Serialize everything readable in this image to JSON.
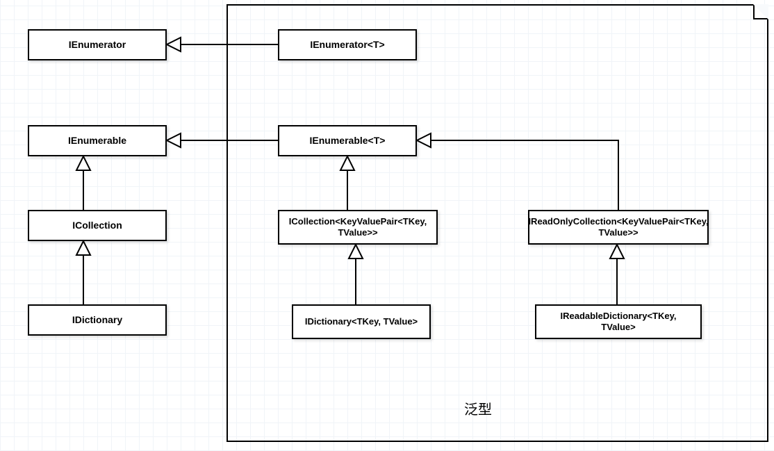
{
  "group": {
    "label": "泛型"
  },
  "boxes": {
    "ienumerator": "IEnumerator",
    "ienumerator_t": "IEnumerator<T>",
    "ienumerable": "IEnumerable",
    "ienumerable_t": "IEnumerable<T>",
    "icollection": "ICollection",
    "idictionary": "IDictionary",
    "icollection_kvp": "ICollection<KeyValuePair<TKey, TValue>>",
    "idictionary_tk": "IDictionary<TKey, TValue>",
    "ireadonlycollection_kvp": "IReadOnlyCollection<KeyValuePair<TKey, TValue>>",
    "ireadabledictionary_tk": "IReadableDictionary<TKey, TValue>"
  }
}
